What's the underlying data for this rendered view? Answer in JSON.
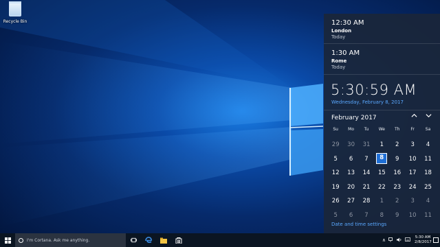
{
  "desktop": {
    "recycle_bin_label": "Recycle Bin"
  },
  "flyout": {
    "clocks": [
      {
        "time": "12:30 AM",
        "city": "London",
        "day": "Today"
      },
      {
        "time": "1:30 AM",
        "city": "Rome",
        "day": "Today"
      }
    ],
    "current_time": "5:30:59 AM",
    "current_date": "Wednesday, February 8, 2017",
    "month_label": "February 2017",
    "weekdays": [
      "Su",
      "Mo",
      "Tu",
      "We",
      "Th",
      "Fr",
      "Sa"
    ],
    "weeks": [
      [
        "29",
        "30",
        "31",
        "1",
        "2",
        "3",
        "4"
      ],
      [
        "5",
        "6",
        "7",
        "8",
        "9",
        "10",
        "11"
      ],
      [
        "12",
        "13",
        "14",
        "15",
        "16",
        "17",
        "18"
      ],
      [
        "19",
        "20",
        "21",
        "22",
        "23",
        "24",
        "25"
      ],
      [
        "26",
        "27",
        "28",
        "1",
        "2",
        "3",
        "4"
      ],
      [
        "5",
        "6",
        "7",
        "8",
        "9",
        "10",
        "11"
      ]
    ],
    "dim_cells": [
      [
        0,
        0
      ],
      [
        0,
        1
      ],
      [
        0,
        2
      ],
      [
        4,
        3
      ],
      [
        4,
        4
      ],
      [
        4,
        5
      ],
      [
        4,
        6
      ],
      [
        5,
        0
      ],
      [
        5,
        1
      ],
      [
        5,
        2
      ],
      [
        5,
        3
      ],
      [
        5,
        4
      ],
      [
        5,
        5
      ],
      [
        5,
        6
      ]
    ],
    "today_cell": [
      1,
      3
    ],
    "settings_link": "Date and time settings",
    "prev_icon": "chevron-up-icon",
    "next_icon": "chevron-down-icon"
  },
  "taskbar": {
    "search_placeholder": "I'm Cortana. Ask me anything.",
    "tray_time": "5:30 AM",
    "tray_date": "2/8/2017"
  },
  "colors": {
    "accent": "#5aa8ff",
    "today_fill": "#1f6fd6",
    "flyout_bg": "#1a263a",
    "taskbar_bg": "#0b1522"
  }
}
